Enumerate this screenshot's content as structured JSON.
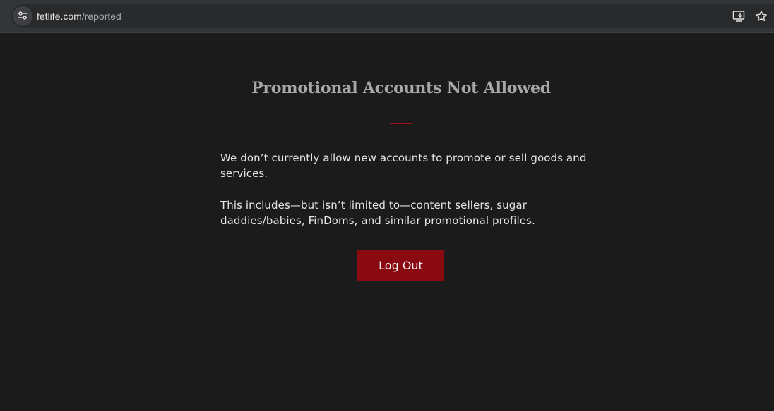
{
  "browser": {
    "url_host": "fetlife.com",
    "url_path": "/reported",
    "icons": {
      "site_info": "tune-icon",
      "install": "install-app-icon",
      "bookmark": "star-icon"
    }
  },
  "main": {
    "title": "Promotional Accounts Not Allowed",
    "paragraph_1": "We don’t currently allow new accounts to promote or sell goods and services.",
    "paragraph_2": "This includes—but isn’t limited to—content sellers, sugar daddies/babies, FinDoms, and similar promotional profiles.",
    "logout_label": "Log Out"
  },
  "colors": {
    "background": "#1b1b1c",
    "accent": "#8a0a12",
    "divider": "#a3101b",
    "title_text": "#a7a7a7",
    "body_text": "#e6e6e6"
  }
}
